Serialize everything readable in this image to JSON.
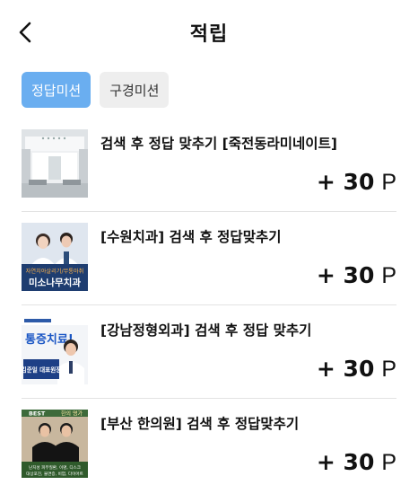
{
  "header": {
    "title": "적립"
  },
  "tabs": [
    {
      "label": "정답미션",
      "active": true
    },
    {
      "label": "구경미션",
      "active": false
    }
  ],
  "missions": [
    {
      "title": "검색 후 정답 맞추기 [죽전동라미네이트]",
      "reward": "+ 30",
      "unit": "P",
      "thumb": {
        "caption": ""
      }
    },
    {
      "title": "[수원치과] 검색 후 정답맞추기",
      "reward": "+ 30",
      "unit": "P",
      "thumb": {
        "tagline": "자연치아살리기/무통마취",
        "name": "미소나무치과"
      }
    },
    {
      "title": "[강남정형외과] 검색 후 정답 맞추기",
      "reward": "+ 30",
      "unit": "P",
      "thumb": {
        "headline": "통증치료!",
        "sub": "김준일 대표원장"
      }
    },
    {
      "title": "[부산 한의원] 검색 후 정답맞추기",
      "reward": "+ 30",
      "unit": "P",
      "thumb": {
        "badge": "BEST",
        "badge2": "한의 명가",
        "caption1": "난치성 피부질환, 이명, 디스크",
        "caption2": "대상포진, 불면증, 비염, 다이어트"
      }
    }
  ],
  "colors": {
    "accent": "#6aaef0",
    "tab_inactive": "#eeeeee"
  }
}
